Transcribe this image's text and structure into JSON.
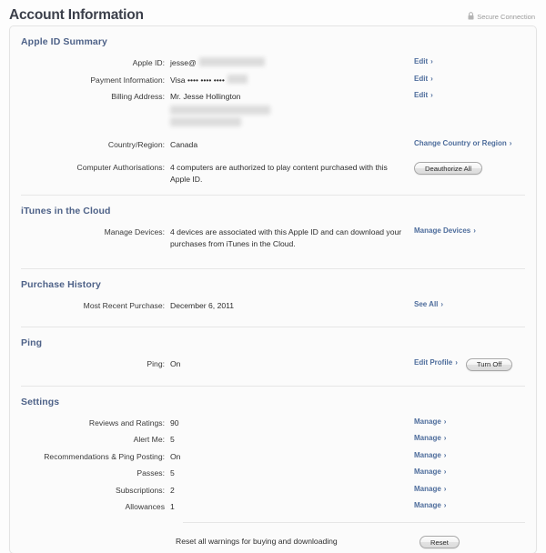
{
  "header": {
    "title": "Account Information",
    "secure_label": "Secure Connection",
    "lock_icon": "lock-icon"
  },
  "sections": {
    "apple_id_summary": {
      "title": "Apple ID Summary",
      "rows": {
        "apple_id": {
          "label": "Apple ID:",
          "value": "jesse@",
          "redacted": true,
          "action": "Edit"
        },
        "payment": {
          "label": "Payment Information:",
          "value": "Visa •••• •••• ••••",
          "redacted": true,
          "action": "Edit"
        },
        "billing": {
          "label": "Billing Address:",
          "value": "Mr. Jesse Hollington",
          "redacted": true,
          "action": "Edit"
        },
        "country": {
          "label": "Country/Region:",
          "value": "Canada",
          "action": "Change Country or Region"
        },
        "computer_auth": {
          "label": "Computer Authorisations:",
          "value": "4 computers are authorized to play content purchased with this Apple ID.",
          "button": "Deauthorize All"
        }
      }
    },
    "itunes_cloud": {
      "title": "iTunes in the Cloud",
      "rows": {
        "manage_devices": {
          "label": "Manage Devices:",
          "value": "4 devices are associated with this Apple ID and can download your purchases from iTunes in the Cloud.",
          "action": "Manage Devices"
        }
      }
    },
    "purchase_history": {
      "title": "Purchase History",
      "rows": {
        "most_recent": {
          "label": "Most Recent Purchase:",
          "value": "December 6, 2011",
          "action": "See All"
        }
      }
    },
    "ping": {
      "title": "Ping",
      "rows": {
        "ping": {
          "label": "Ping:",
          "value": "On",
          "action": "Edit Profile",
          "button": "Turn Off"
        }
      }
    },
    "settings": {
      "title": "Settings",
      "rows": [
        {
          "label": "Reviews and Ratings:",
          "value": "90",
          "action": "Manage"
        },
        {
          "label": "Alert Me:",
          "value": "5",
          "action": "Manage"
        },
        {
          "label": "Recommendations & Ping Posting:",
          "value": "On",
          "action": "Manage"
        },
        {
          "label": "Passes:",
          "value": "5",
          "action": "Manage"
        },
        {
          "label": "Subscriptions:",
          "value": "2",
          "action": "Manage"
        },
        {
          "label": "Allowances",
          "value": "1",
          "action": "Manage"
        }
      ],
      "footer": {
        "text": "Reset all warnings for buying and downloading",
        "button": "Reset"
      }
    }
  },
  "colors": {
    "section_title": "#4e6288",
    "link": "#4e6d9c",
    "page_title": "#3b3f4a",
    "panel_bg": "#fbfbfb",
    "border": "#e4e4e4"
  },
  "chevron": "›"
}
